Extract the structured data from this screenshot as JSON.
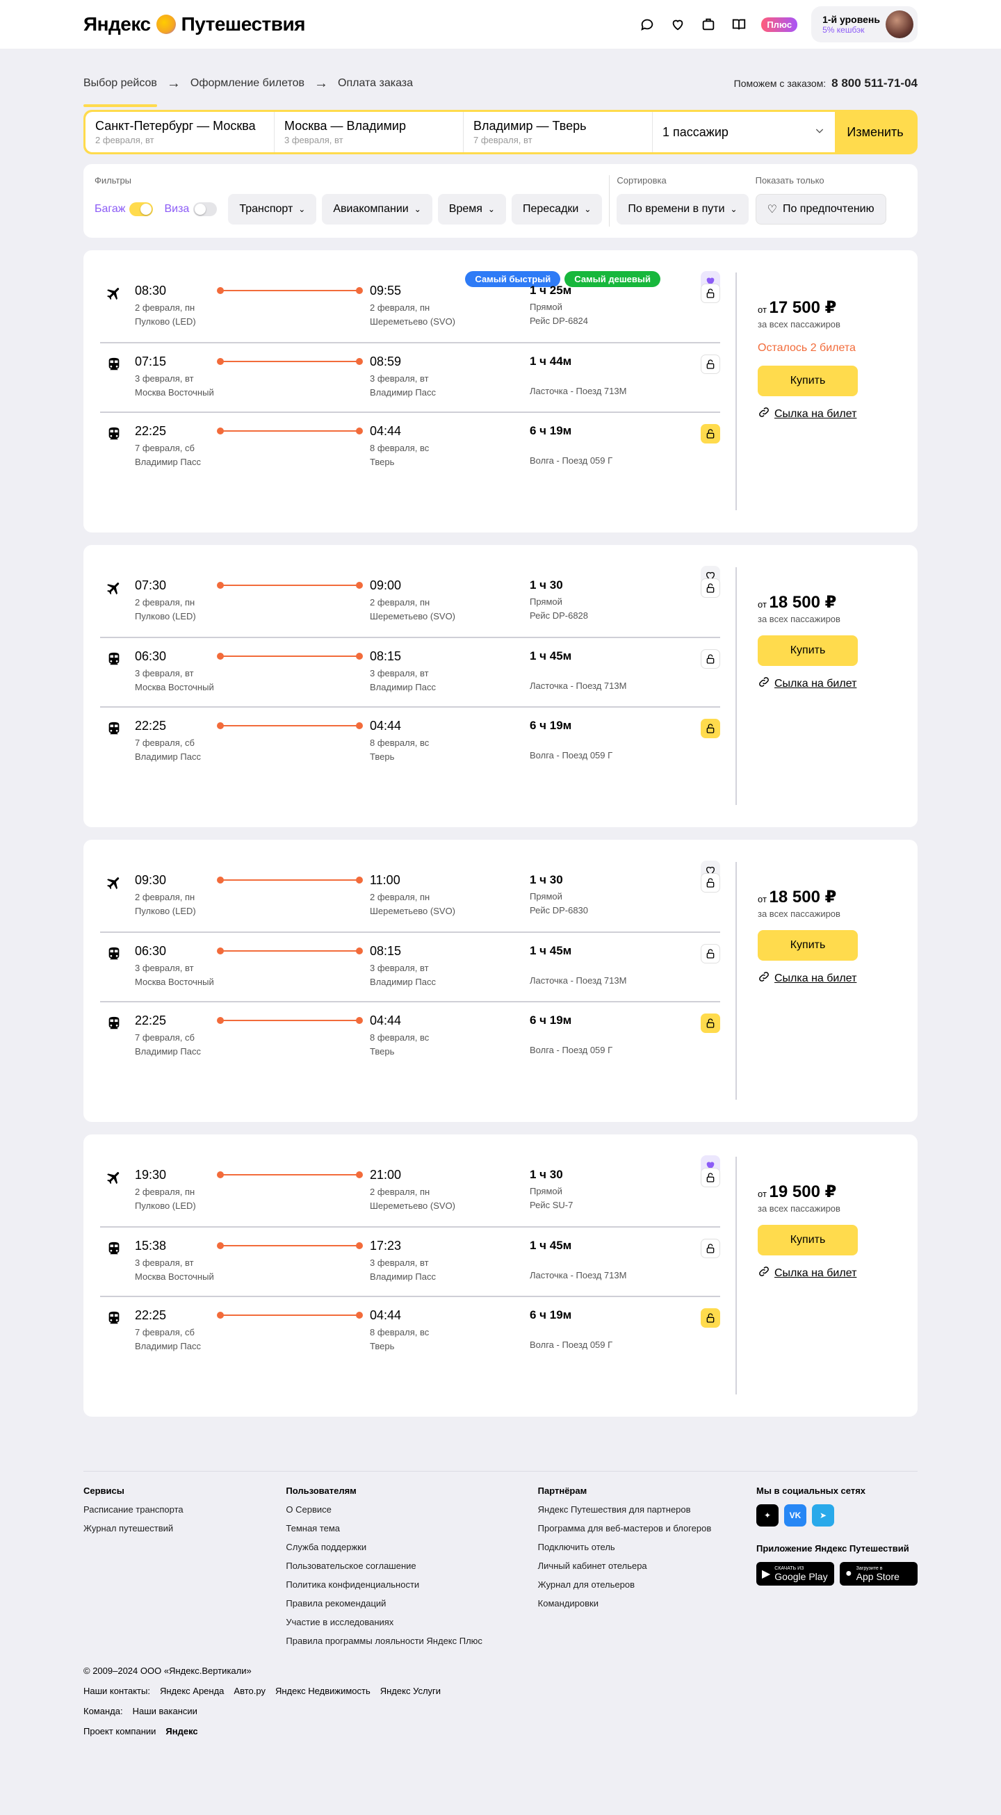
{
  "header": {
    "logo_text": "Яндекс",
    "logo_sub": "Путешествия",
    "plus_label": "Плюс",
    "user_level": "1-й уровень",
    "cashback": "5% кешбэк"
  },
  "steps": [
    "Выбор рейсов",
    "Оформление билетов",
    "Оплата заказа"
  ],
  "support": {
    "label": "Поможем с заказом:",
    "phone": "8 800 511-71-04"
  },
  "search": {
    "segments": [
      {
        "route": "Санкт-Петербург — Москва",
        "date": "2 февраля, вт"
      },
      {
        "route": "Москва — Владимир",
        "date": "3 февраля, вт"
      },
      {
        "route": "Владимир — Тверь",
        "date": "7 февраля, вт"
      }
    ],
    "passengers": "1 пассажир",
    "change_label": "Изменить"
  },
  "filters": {
    "label": "Фильтры",
    "baggage": "Багаж",
    "visa": "Виза",
    "buttons": [
      "Транспорт",
      "Авиакомпании",
      "Время",
      "Пересадки"
    ],
    "sort_label": "Сортировка",
    "sort_value": "По времени в пути",
    "show_label": "Показать только",
    "show_value": "По предпочтению"
  },
  "badges": {
    "fast": "Самый быстрый",
    "cheap": "Самый дешевый"
  },
  "price_prefix": "от",
  "price_sub": "за всех пассажиров",
  "buy_label": "Купить",
  "link_label": "Сылка на билет",
  "offers": [
    {
      "price": "17 500 ₽",
      "seats_left": "Осталось 2 билета",
      "fav_active": true,
      "legs": [
        {
          "type": "plane",
          "dep_time": "08:30",
          "dep_date": "2 февраля, пн",
          "dep_place": "Пулково (LED)",
          "arr_time": "09:55",
          "arr_date": "2 февраля, пн",
          "arr_place": "Шереметьево (SVO)",
          "duration": "1 ч 25м",
          "info1": "Прямой",
          "info2": "Рейс DP-6824",
          "locked": false
        },
        {
          "type": "train",
          "dep_time": "07:15",
          "dep_date": "3 февраля, вт",
          "dep_place": "Москва Восточный",
          "arr_time": "08:59",
          "arr_date": "3 февраля, вт",
          "arr_place": "Владимир Пасс",
          "duration": "1 ч 44м",
          "info1": "",
          "info2": "Ласточка - Поезд 713М",
          "locked": false
        },
        {
          "type": "train",
          "dep_time": "22:25",
          "dep_date": "7 февраля, сб",
          "dep_place": "Владимир Пасс",
          "arr_time": "04:44",
          "arr_date": "8 февраля, вс",
          "arr_place": "Тверь",
          "duration": "6 ч 19м",
          "info1": "",
          "info2": "Волга - Поезд 059 Г",
          "locked": true
        }
      ]
    },
    {
      "price": "18 500 ₽",
      "seats_left": "",
      "fav_active": false,
      "legs": [
        {
          "type": "plane",
          "dep_time": "07:30",
          "dep_date": "2 февраля, пн",
          "dep_place": "Пулково (LED)",
          "arr_time": "09:00",
          "arr_date": "2 февраля, пн",
          "arr_place": "Шереметьево (SVO)",
          "duration": "1 ч 30",
          "info1": "Прямой",
          "info2": "Рейс DP-6828",
          "locked": false
        },
        {
          "type": "train",
          "dep_time": "06:30",
          "dep_date": "3 февраля, вт",
          "dep_place": "Москва Восточный",
          "arr_time": "08:15",
          "arr_date": "3 февраля, вт",
          "arr_place": "Владимир Пасс",
          "duration": "1 ч 45м",
          "info1": "",
          "info2": "Ласточка - Поезд 713М",
          "locked": false
        },
        {
          "type": "train",
          "dep_time": "22:25",
          "dep_date": "7 февраля, сб",
          "dep_place": "Владимир Пасс",
          "arr_time": "04:44",
          "arr_date": "8 февраля, вс",
          "arr_place": "Тверь",
          "duration": "6 ч 19м",
          "info1": "",
          "info2": "Волга - Поезд 059 Г",
          "locked": true
        }
      ]
    },
    {
      "price": "18 500 ₽",
      "seats_left": "",
      "fav_active": false,
      "legs": [
        {
          "type": "plane",
          "dep_time": "09:30",
          "dep_date": "2 февраля, пн",
          "dep_place": "Пулково (LED)",
          "arr_time": "11:00",
          "arr_date": "2 февраля, пн",
          "arr_place": "Шереметьево (SVO)",
          "duration": "1 ч 30",
          "info1": "Прямой",
          "info2": "Рейс DP-6830",
          "locked": false
        },
        {
          "type": "train",
          "dep_time": "06:30",
          "dep_date": "3 февраля, вт",
          "dep_place": "Москва Восточный",
          "arr_time": "08:15",
          "arr_date": "3 февраля, вт",
          "arr_place": "Владимир Пасс",
          "duration": "1 ч 45м",
          "info1": "",
          "info2": "Ласточка - Поезд 713М",
          "locked": false
        },
        {
          "type": "train",
          "dep_time": "22:25",
          "dep_date": "7 февраля, сб",
          "dep_place": "Владимир Пасс",
          "arr_time": "04:44",
          "arr_date": "8 февраля, вс",
          "arr_place": "Тверь",
          "duration": "6 ч 19м",
          "info1": "",
          "info2": "Волга - Поезд 059 Г",
          "locked": true
        }
      ]
    },
    {
      "price": "19 500 ₽",
      "seats_left": "",
      "fav_active": true,
      "legs": [
        {
          "type": "plane",
          "dep_time": "19:30",
          "dep_date": "2 февраля, пн",
          "dep_place": "Пулково (LED)",
          "arr_time": "21:00",
          "arr_date": "2 февраля, пн",
          "arr_place": "Шереметьево (SVO)",
          "duration": "1 ч 30",
          "info1": "Прямой",
          "info2": "Рейс SU-7",
          "locked": false
        },
        {
          "type": "train",
          "dep_time": "15:38",
          "dep_date": "3 февраля, вт",
          "dep_place": "Москва Восточный",
          "arr_time": "17:23",
          "arr_date": "3 февраля, вт",
          "arr_place": "Владимир Пасс",
          "duration": "1 ч 45м",
          "info1": "",
          "info2": "Ласточка - Поезд 713М",
          "locked": false
        },
        {
          "type": "train",
          "dep_time": "22:25",
          "dep_date": "7 февраля, сб",
          "dep_place": "Владимир Пасс",
          "arr_time": "04:44",
          "arr_date": "8 февраля, вс",
          "arr_place": "Тверь",
          "duration": "6 ч 19м",
          "info1": "",
          "info2": "Волга - Поезд 059 Г",
          "locked": true
        }
      ]
    }
  ],
  "footer": {
    "services": {
      "title": "Сервисы",
      "items": [
        "Расписание транспорта",
        "Журнал путешествий"
      ]
    },
    "users": {
      "title": "Пользователям",
      "items": [
        "О Сервисе",
        "Темная тема",
        "Служба поддержки",
        "Пользовательское соглашение",
        "Политика конфиденциальности",
        "Правила рекомендаций",
        "Участие в исследованиях",
        "Правила программы лояльности Яндекс Плюс"
      ]
    },
    "partners": {
      "title": "Партнёрам",
      "items": [
        "Яндекс Путешествия для партнеров",
        "Программа для веб-мастеров и блогеров",
        "Подключить отель",
        "Личный кабинет отельера",
        "Журнал для отельеров",
        "Командировки"
      ]
    },
    "social_title": "Мы в социальных сетях",
    "app_title": "Приложение Яндекс Путешествий",
    "google_small": "СКАЧАТЬ ИЗ",
    "google_big": "Google Play",
    "apple_small": "Загрузите в",
    "apple_big": "App Store"
  },
  "bottom": {
    "copyright": "© 2009–2024 ООО «Яндекс.Вертикали»",
    "contacts_label": "Наши контакты:",
    "contacts": [
      "Яндекс Аренда",
      "Авто.ру",
      "Яндекс Недвижимость",
      "Яндекс Услуги"
    ],
    "team_label": "Команда:",
    "team_link": "Наши вакансии",
    "project_label": "Проект компании",
    "project_brand": "Яндекс"
  },
  "colors": {
    "accent": "#ffdb4d",
    "route": "#f26b3a",
    "purple": "#8c5cf6",
    "fast": "#2e7bf6",
    "cheap": "#17b73c"
  }
}
